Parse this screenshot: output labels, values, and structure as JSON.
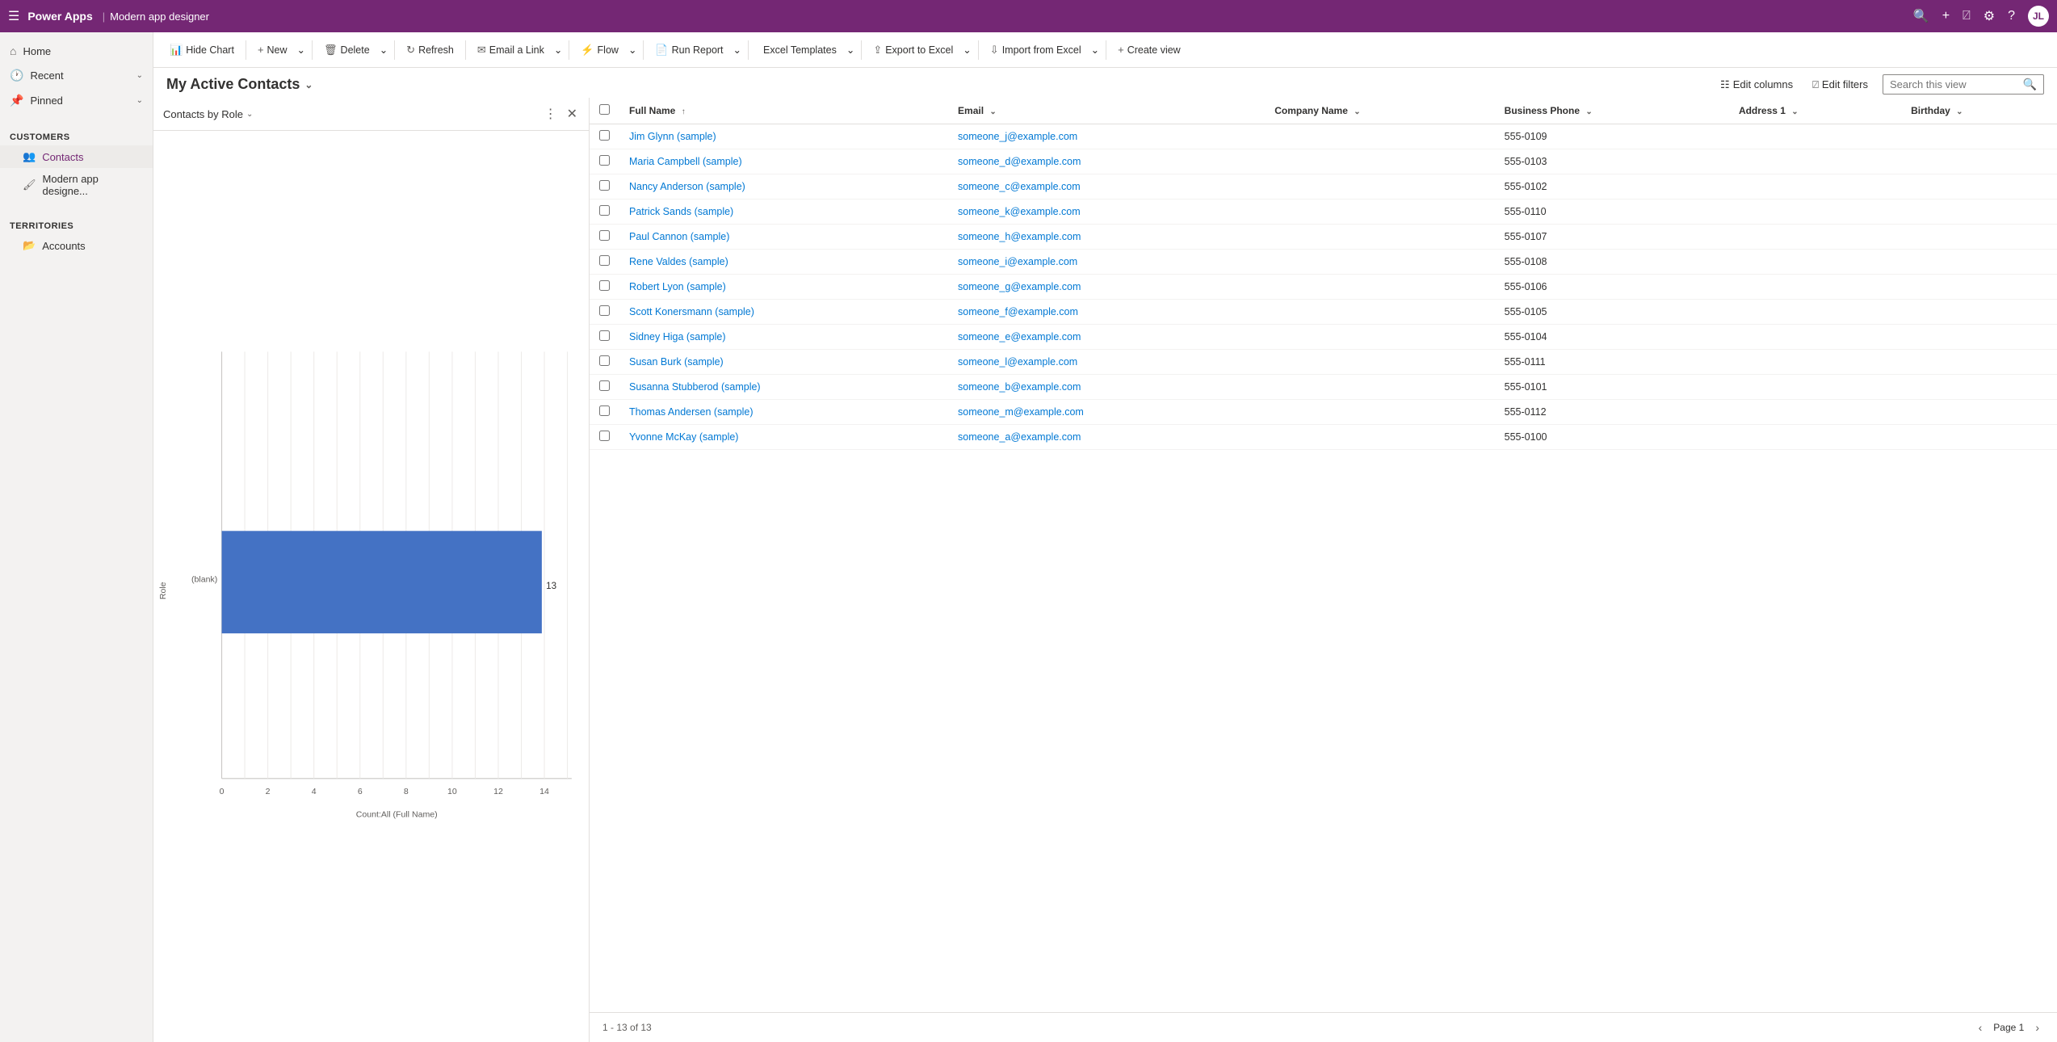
{
  "app": {
    "name": "Power Apps",
    "page_title": "Modern app designer"
  },
  "topnav": {
    "icons": [
      "search",
      "add",
      "filter",
      "settings",
      "help",
      "user"
    ]
  },
  "sidebar": {
    "home_label": "Home",
    "recent_label": "Recent",
    "pinned_label": "Pinned",
    "customers_label": "Customers",
    "contacts_label": "Contacts",
    "modern_app_label": "Modern app designe...",
    "territories_label": "Territories",
    "accounts_label": "Accounts"
  },
  "toolbar": {
    "hide_chart": "Hide Chart",
    "new": "New",
    "delete": "Delete",
    "refresh": "Refresh",
    "email_link": "Email a Link",
    "flow": "Flow",
    "run_report": "Run Report",
    "excel_templates": "Excel Templates",
    "export_excel": "Export to Excel",
    "import_excel": "Import from Excel",
    "create_view": "Create view"
  },
  "view": {
    "title": "My Active Contacts",
    "edit_columns": "Edit columns",
    "edit_filters": "Edit filters",
    "search_placeholder": "Search this view"
  },
  "chart": {
    "title": "Contacts by Role",
    "bar_value": 13,
    "y_label": "Role",
    "x_label": "Count:All (Full Name)",
    "blank_label": "(blank)",
    "x_ticks": [
      "0",
      "2",
      "4",
      "6",
      "8",
      "10",
      "12",
      "14"
    ],
    "bar_color": "#4472C4"
  },
  "table": {
    "columns": [
      {
        "label": "Full Name",
        "sort": "asc"
      },
      {
        "label": "Email",
        "sort": "desc"
      },
      {
        "label": "Company Name",
        "sort": "none"
      },
      {
        "label": "Business Phone",
        "sort": "none"
      },
      {
        "label": "Address 1",
        "sort": "none"
      },
      {
        "label": "Birthday",
        "sort": "none"
      }
    ],
    "rows": [
      {
        "name": "Jim Glynn (sample)",
        "email": "someone_j@example.com",
        "company": "",
        "phone": "555-0109",
        "address": "",
        "birthday": ""
      },
      {
        "name": "Maria Campbell (sample)",
        "email": "someone_d@example.com",
        "company": "",
        "phone": "555-0103",
        "address": "",
        "birthday": ""
      },
      {
        "name": "Nancy Anderson (sample)",
        "email": "someone_c@example.com",
        "company": "",
        "phone": "555-0102",
        "address": "",
        "birthday": ""
      },
      {
        "name": "Patrick Sands (sample)",
        "email": "someone_k@example.com",
        "company": "",
        "phone": "555-0110",
        "address": "",
        "birthday": ""
      },
      {
        "name": "Paul Cannon (sample)",
        "email": "someone_h@example.com",
        "company": "",
        "phone": "555-0107",
        "address": "",
        "birthday": ""
      },
      {
        "name": "Rene Valdes (sample)",
        "email": "someone_i@example.com",
        "company": "",
        "phone": "555-0108",
        "address": "",
        "birthday": ""
      },
      {
        "name": "Robert Lyon (sample)",
        "email": "someone_g@example.com",
        "company": "",
        "phone": "555-0106",
        "address": "",
        "birthday": ""
      },
      {
        "name": "Scott Konersmann (sample)",
        "email": "someone_f@example.com",
        "company": "",
        "phone": "555-0105",
        "address": "",
        "birthday": ""
      },
      {
        "name": "Sidney Higa (sample)",
        "email": "someone_e@example.com",
        "company": "",
        "phone": "555-0104",
        "address": "",
        "birthday": ""
      },
      {
        "name": "Susan Burk (sample)",
        "email": "someone_l@example.com",
        "company": "",
        "phone": "555-0111",
        "address": "",
        "birthday": ""
      },
      {
        "name": "Susanna Stubberod (sample)",
        "email": "someone_b@example.com",
        "company": "",
        "phone": "555-0101",
        "address": "",
        "birthday": ""
      },
      {
        "name": "Thomas Andersen (sample)",
        "email": "someone_m@example.com",
        "company": "",
        "phone": "555-0112",
        "address": "",
        "birthday": ""
      },
      {
        "name": "Yvonne McKay (sample)",
        "email": "someone_a@example.com",
        "company": "",
        "phone": "555-0100",
        "address": "",
        "birthday": ""
      }
    ],
    "footer": {
      "count_text": "1 - 13 of 13",
      "page_text": "Page 1"
    }
  }
}
